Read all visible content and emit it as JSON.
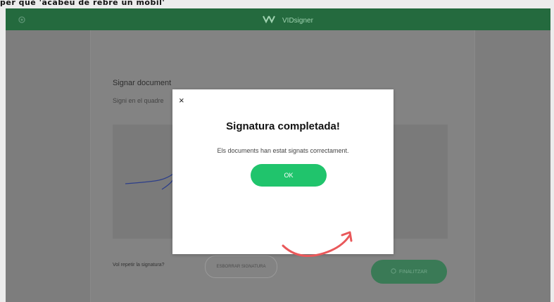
{
  "caption": "per què 'acabeu de rebre un mòbil'",
  "header": {
    "app_name": "VIDsigner",
    "left_icon": "gear-icon"
  },
  "page": {
    "title": "Signar document",
    "instruction": "Signi en el quadre",
    "retry_text": "Vol repetir la signatura?",
    "erase_button": "ESBORRAR SIGNATURA",
    "finish_button": "FINALITZAR"
  },
  "modal": {
    "close_label": "×",
    "title": "Signatura completada!",
    "message": "Els documents han estat signats correctament.",
    "ok_button": "OK"
  },
  "colors": {
    "header": "#246a3e",
    "ok_button": "#20c46c",
    "arrow": "#e9585a"
  }
}
